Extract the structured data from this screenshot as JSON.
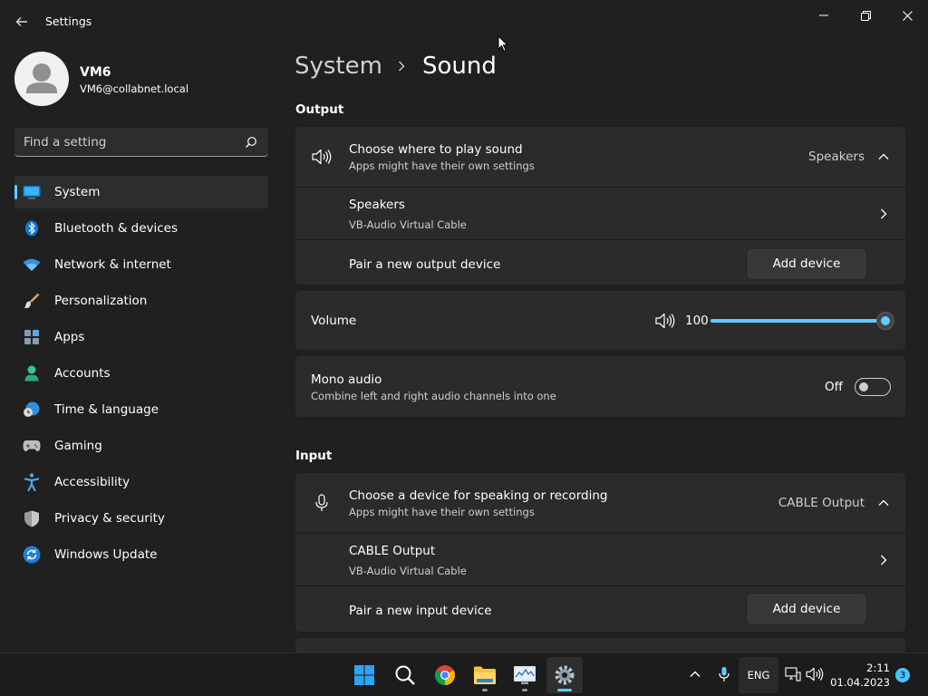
{
  "window": {
    "title": "Settings"
  },
  "profile": {
    "name": "VM6",
    "email": "VM6@collabnet.local"
  },
  "search": {
    "placeholder": "Find a setting"
  },
  "nav": [
    {
      "label": "System",
      "icon": "monitor-icon",
      "active": true
    },
    {
      "label": "Bluetooth & devices",
      "icon": "bluetooth-icon"
    },
    {
      "label": "Network & internet",
      "icon": "wifi-icon"
    },
    {
      "label": "Personalization",
      "icon": "paintbrush-icon"
    },
    {
      "label": "Apps",
      "icon": "apps-icon"
    },
    {
      "label": "Accounts",
      "icon": "person-icon"
    },
    {
      "label": "Time & language",
      "icon": "globe-clock-icon"
    },
    {
      "label": "Gaming",
      "icon": "gamepad-icon"
    },
    {
      "label": "Accessibility",
      "icon": "accessibility-icon"
    },
    {
      "label": "Privacy & security",
      "icon": "shield-icon"
    },
    {
      "label": "Windows Update",
      "icon": "update-icon"
    }
  ],
  "breadcrumb": {
    "parent": "System",
    "current": "Sound"
  },
  "output": {
    "section_title": "Output",
    "choose_title": "Choose where to play sound",
    "choose_sub": "Apps might have their own settings",
    "selected": "Speakers",
    "device_name": "Speakers",
    "device_sub": "VB-Audio Virtual Cable",
    "pair_label": "Pair a new output device",
    "add_button": "Add device"
  },
  "volume": {
    "label": "Volume",
    "value": "100",
    "level": 1.0
  },
  "mono": {
    "title": "Mono audio",
    "sub": "Combine left and right audio channels into one",
    "state": "Off"
  },
  "input": {
    "section_title": "Input",
    "choose_title": "Choose a device for speaking or recording",
    "choose_sub": "Apps might have their own settings",
    "selected": "CABLE Output",
    "device_name": "CABLE Output",
    "device_sub": "VB-Audio Virtual Cable",
    "pair_label": "Pair a new input device",
    "add_button": "Add device"
  },
  "taskbar": {
    "apps": [
      "start-icon",
      "search-icon",
      "chrome-icon",
      "file-explorer-icon",
      "performance-monitor-icon",
      "settings-icon"
    ],
    "language": "ENG",
    "time": "2:11",
    "date": "01.04.2023",
    "notifications": "3"
  },
  "colors": {
    "accent": "#60cdff",
    "background": "#202020",
    "card": "#2b2b2b"
  }
}
